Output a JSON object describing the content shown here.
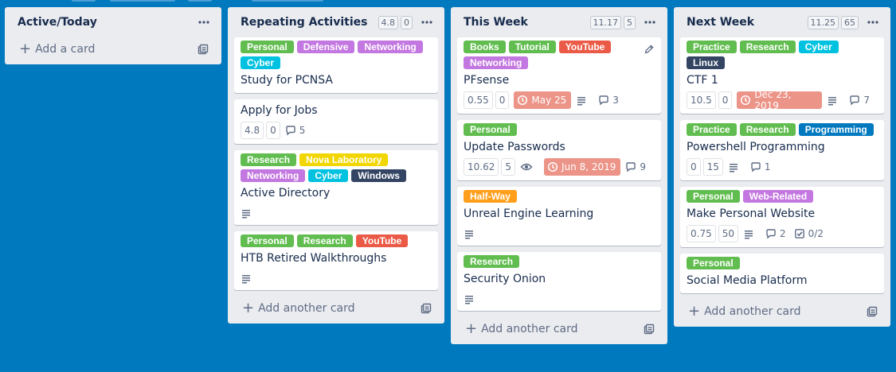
{
  "lists": [
    {
      "title": "Active/Today",
      "add_label": "Add a card",
      "cards": []
    },
    {
      "title": "Repeating Activities",
      "badges": [
        "4.8",
        "0"
      ],
      "add_label": "Add another card",
      "cards": [
        {
          "labels": [
            {
              "text": "Personal",
              "color": "#61bd4f"
            },
            {
              "text": "Defensive",
              "color": "#c377e0"
            },
            {
              "text": "Networking",
              "color": "#c377e0"
            },
            {
              "text": "Cyber",
              "color": "#00c2e0"
            }
          ],
          "title": "Study for PCNSA"
        },
        {
          "title": "Apply for Jobs",
          "badges": [
            "4.8",
            "0"
          ],
          "comments": "5"
        },
        {
          "labels": [
            {
              "text": "Research",
              "color": "#61bd4f"
            },
            {
              "text": "Nova Laboratory",
              "color": "#f2d600"
            },
            {
              "text": "Networking",
              "color": "#c377e0"
            },
            {
              "text": "Cyber",
              "color": "#00c2e0"
            },
            {
              "text": "Windows",
              "color": "#344563"
            }
          ],
          "title": "Active Directory",
          "has_description": true
        },
        {
          "labels": [
            {
              "text": "Personal",
              "color": "#61bd4f"
            },
            {
              "text": "Research",
              "color": "#61bd4f"
            },
            {
              "text": "YouTube",
              "color": "#eb5a46"
            }
          ],
          "title": "HTB Retired Walkthroughs",
          "has_description": true
        }
      ]
    },
    {
      "title": "This Week",
      "badges": [
        "11.17",
        "5"
      ],
      "add_label": "Add another card",
      "cards": [
        {
          "labels": [
            {
              "text": "Books",
              "color": "#61bd4f"
            },
            {
              "text": "Tutorial",
              "color": "#61bd4f"
            },
            {
              "text": "YouTube",
              "color": "#eb5a46"
            },
            {
              "text": "Networking",
              "color": "#c377e0"
            }
          ],
          "title": "PFsense",
          "badges": [
            "0.55",
            "0"
          ],
          "due": "May 25",
          "comments": "3",
          "has_description": true
        },
        {
          "labels": [
            {
              "text": "Personal",
              "color": "#61bd4f"
            }
          ],
          "title": "Update Passwords",
          "badges": [
            "10.62",
            "5"
          ],
          "watching": true,
          "due": "Jun 8, 2019",
          "comments": "9"
        },
        {
          "labels": [
            {
              "text": "Half-Way",
              "color": "#ff9f1a"
            }
          ],
          "title": "Unreal Engine Learning",
          "has_description": true
        },
        {
          "labels": [
            {
              "text": "Research",
              "color": "#61bd4f"
            }
          ],
          "title": "Security Onion",
          "has_description": true
        }
      ]
    },
    {
      "title": "Next Week",
      "badges": [
        "11.25",
        "65"
      ],
      "add_label": "Add another card",
      "cards": [
        {
          "labels": [
            {
              "text": "Practice",
              "color": "#61bd4f"
            },
            {
              "text": "Research",
              "color": "#61bd4f"
            },
            {
              "text": "Cyber",
              "color": "#00c2e0"
            },
            {
              "text": "Linux",
              "color": "#344563"
            }
          ],
          "title": "CTF 1",
          "badges": [
            "10.5",
            "0"
          ],
          "due": "Dec 23, 2019",
          "comments": "7",
          "has_description": true
        },
        {
          "labels": [
            {
              "text": "Practice",
              "color": "#61bd4f"
            },
            {
              "text": "Research",
              "color": "#61bd4f"
            },
            {
              "text": "Programming",
              "color": "#0079bf"
            }
          ],
          "title": "Powershell Programming",
          "badges": [
            "0",
            "15"
          ],
          "comments": "1",
          "has_description": true
        },
        {
          "labels": [
            {
              "text": "Personal",
              "color": "#61bd4f"
            },
            {
              "text": "Web-Related",
              "color": "#c377e0"
            }
          ],
          "title": "Make Personal Website",
          "badges": [
            "0.75",
            "50"
          ],
          "comments": "2",
          "checklist": "0/2",
          "has_description": true
        },
        {
          "labels": [
            {
              "text": "Personal",
              "color": "#61bd4f"
            }
          ],
          "title": "Social Media Platform"
        }
      ]
    }
  ],
  "icons": {
    "menu": "ellipsis-icon",
    "template": "card-template-icon",
    "description": "description-icon",
    "comment": "comment-icon",
    "clock": "clock-icon",
    "eye": "eye-icon",
    "checklist": "checklist-icon",
    "edit": "pencil-icon"
  }
}
